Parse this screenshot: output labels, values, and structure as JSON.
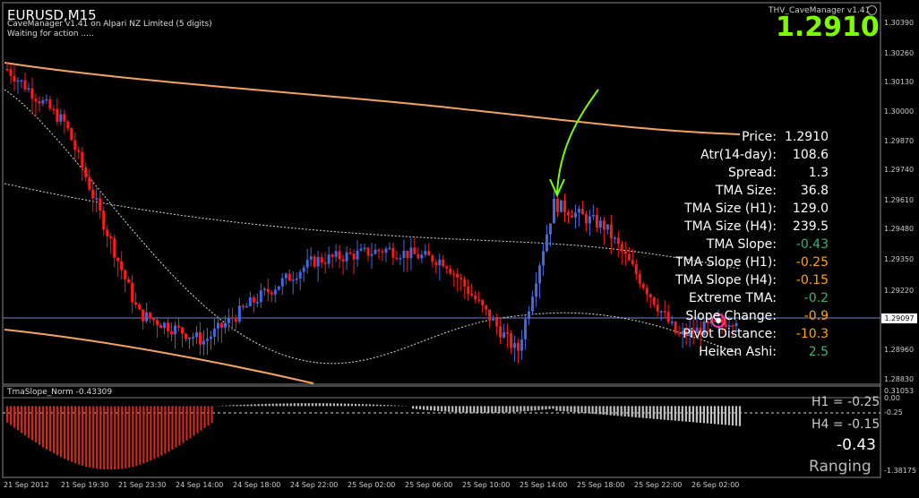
{
  "header": {
    "symbol": "EURUSD,M15",
    "broker_line": "CaveManager v1.41 on Alpari NZ Limited (5 digits)",
    "status_line": "Waiting for action .....",
    "ea_name": "THV_CaveManager v1.41",
    "big_price": "1.2910"
  },
  "panel": {
    "rows": [
      {
        "label": "Price:",
        "value": "1.2910",
        "color": "#ffffff"
      },
      {
        "label": "Atr(14-day):",
        "value": "108.6",
        "color": "#ffffff"
      },
      {
        "label": "Spread:",
        "value": "1.3",
        "color": "#ffffff"
      },
      {
        "label": "TMA Size:",
        "value": "36.8",
        "color": "#ffffff"
      },
      {
        "label": "TMA Size (H1):",
        "value": "129.0",
        "color": "#ffffff"
      },
      {
        "label": "TMA Size (H4):",
        "value": "239.5",
        "color": "#ffffff"
      },
      {
        "label": "TMA Slope:",
        "value": "-0.43",
        "color": "#3cb371"
      },
      {
        "label": "TMA Slope (H1):",
        "value": "-0.25",
        "color": "#ffa500"
      },
      {
        "label": "TMA Slope (H4):",
        "value": "-0.15",
        "color": "#ffa500"
      },
      {
        "label": "Extreme TMA:",
        "value": "-0.2",
        "color": "#3cb371"
      },
      {
        "label": "Slope Change:",
        "value": "-0.9",
        "color": "#ffa500"
      },
      {
        "label": "Pivot Distance:",
        "value": "-10.3",
        "color": "#ffa500"
      },
      {
        "label": "Heiken Ashi:",
        "value": "2.5",
        "color": "#3cb371"
      }
    ]
  },
  "price_axis": {
    "labels": [
      "1.30390",
      "1.30260",
      "1.30130",
      "1.30000",
      "1.29870",
      "1.29740",
      "1.29610",
      "1.29480",
      "1.29350",
      "1.29220",
      "1.29097",
      "1.28960",
      "1.28830"
    ],
    "current": "1.29097"
  },
  "time_axis": {
    "labels": [
      "21 Sep 2012",
      "21 Sep 19:30",
      "21 Sep 23:30",
      "24 Sep 14:00",
      "24 Sep 18:00",
      "24 Sep 22:00",
      "25 Sep 02:00",
      "25 Sep 06:00",
      "25 Sep 10:00",
      "25 Sep 14:00",
      "25 Sep 18:00",
      "25 Sep 22:00",
      "26 Sep 02:00"
    ]
  },
  "subwindow": {
    "title": "TmaSlope_Norm -0.43309",
    "axis_labels": [
      "0.31053",
      "0.00",
      "-0.25",
      "-1.38175"
    ],
    "h1": "H1 = -0.25",
    "h4": "H4 = -0.15",
    "current": "-0.43",
    "state": "Ranging"
  },
  "colors": {
    "bull": "#4169e1",
    "bear": "#ff1a1a",
    "band": "#f4a460",
    "annotation": "#7cfc00",
    "hist_neg": "#dc2318",
    "hist_pos": "#c0c0c0"
  },
  "chart_data": {
    "type": "line",
    "main_series": [
      {
        "x": "21 Sep 2012",
        "y": 1.3019
      },
      {
        "x": "21 Sep 19:30",
        "y": 1.2995
      },
      {
        "x": "21 Sep 23:30",
        "y": 1.2912
      },
      {
        "x": "24 Sep 14:00",
        "y": 1.29
      },
      {
        "x": "24 Sep 18:00",
        "y": 1.2918
      },
      {
        "x": "24 Sep 22:00",
        "y": 1.2935
      },
      {
        "x": "25 Sep 02:00",
        "y": 1.294
      },
      {
        "x": "25 Sep 06:00",
        "y": 1.2935
      },
      {
        "x": "25 Sep 10:00",
        "y": 1.2895
      },
      {
        "x": "25 Sep 14:00",
        "y": 1.296
      },
      {
        "x": "25 Sep 18:00",
        "y": 1.295
      },
      {
        "x": "25 Sep 22:00",
        "y": 1.2902
      },
      {
        "x": "26 Sep 02:00",
        "y": 1.291
      }
    ],
    "ylim": [
      1.2883,
      1.3039
    ],
    "histogram": {
      "min": -1.38175,
      "max": 0.31053,
      "current": -0.43309,
      "levels": [
        0.0,
        -0.25
      ]
    }
  }
}
